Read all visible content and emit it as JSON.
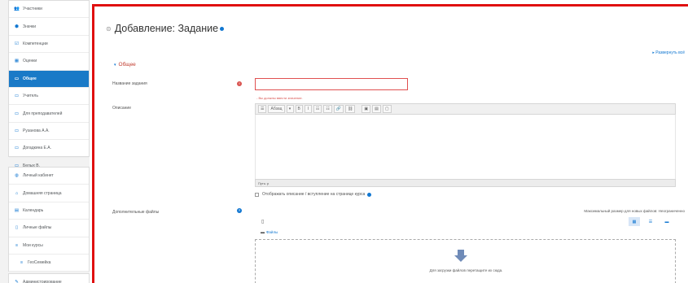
{
  "sidebar": {
    "group1": [
      {
        "icon": "users-icon",
        "glyph": "👥",
        "label": "Участники"
      },
      {
        "icon": "badge-icon",
        "glyph": "⬢",
        "label": "Значки"
      },
      {
        "icon": "competencies-icon",
        "glyph": "☑",
        "label": "Компетенции"
      },
      {
        "icon": "grades-icon",
        "glyph": "▦",
        "label": "Оценки"
      },
      {
        "icon": "folder-icon",
        "glyph": "▭",
        "label": "Общее",
        "active": true
      },
      {
        "icon": "folder-icon",
        "glyph": "▭",
        "label": "Учитель"
      },
      {
        "icon": "folder-icon",
        "glyph": "▭",
        "label": "Для преподавателей"
      },
      {
        "icon": "folder-icon",
        "glyph": "▭",
        "label": "Рузанова А.А."
      },
      {
        "icon": "folder-icon",
        "glyph": "▭",
        "label": "Догадкина Е.А."
      }
    ],
    "group1_extra": {
      "icon": "folder-icon",
      "glyph": "▭",
      "label": "Белых В."
    },
    "group2": [
      {
        "icon": "dashboard-icon",
        "glyph": "◍",
        "label": "Личный кабинет"
      },
      {
        "icon": "home-icon",
        "glyph": "⌂",
        "label": "Домашняя страница"
      },
      {
        "icon": "calendar-icon",
        "glyph": "▤",
        "label": "Календарь"
      },
      {
        "icon": "file-icon",
        "glyph": "▯",
        "label": "Личные файлы"
      },
      {
        "icon": "courses-icon",
        "glyph": "≡",
        "label": "Мои курсы"
      },
      {
        "icon": "course-icon",
        "glyph": "≡",
        "label": "ГеоСемейка",
        "sub": true
      }
    ],
    "group3": [
      {
        "icon": "wrench-icon",
        "glyph": "✎",
        "label": "Администрирование"
      }
    ]
  },
  "page": {
    "title": "Добавление: Задание",
    "expand_all": "Развернуть всё",
    "section_general": "Общее",
    "field_name_label": "Название задания",
    "field_name_error": "- Вы должны ввести значение.",
    "field_description_label": "Описание",
    "editor_status": "Путь: p",
    "display_description": "Отображать описание / вступление на странице курса",
    "additional_files_label": "Дополнительные файлы",
    "max_size": "Максимальный размер для новых файлов: Неограниченно",
    "fp_path": "Файлы",
    "drop_text": "Для загрузки файлов перетащите их сюда."
  },
  "editor_toolbar": [
    "☰",
    "Абзац",
    "▾",
    "B",
    "I",
    "☷",
    "☷",
    "🔗",
    "⛓",
    "",
    "▣",
    "▤",
    "▢"
  ],
  "colors": {
    "accent": "#1177d1",
    "active_bg": "#1a7ac7",
    "error": "#d9534f",
    "outline": "#e01010"
  }
}
